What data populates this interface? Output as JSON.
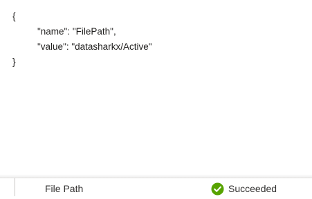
{
  "json_output": {
    "lines": [
      "{",
      "\"name\": \"FilePath\",",
      "\"value\": \"datasharkx/Active\"",
      "}"
    ]
  },
  "activity_row": {
    "name": "File Path",
    "status": "Succeeded",
    "status_icon": "check-circle-icon",
    "status_color": "#57a300"
  }
}
